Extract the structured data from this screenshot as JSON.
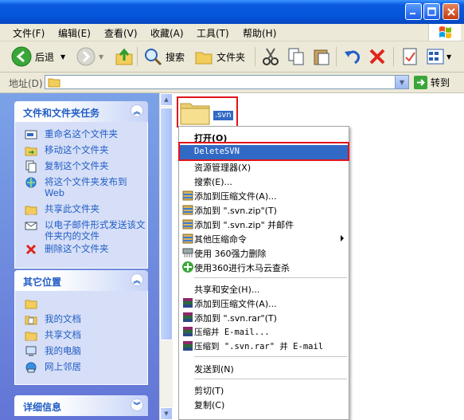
{
  "menubar": {
    "items": [
      "文件(F)",
      "编辑(E)",
      "查看(V)",
      "收藏(A)",
      "工具(T)",
      "帮助(H)"
    ]
  },
  "toolbar": {
    "back_label": "后退",
    "search_label": "搜索",
    "folders_label": "文件夹"
  },
  "addressbar": {
    "label": "地址(D)",
    "value": "",
    "go_label": "转到"
  },
  "left_pane": {
    "file_tasks": {
      "title": "文件和文件夹任务",
      "items": [
        "重命名这个文件夹",
        "移动这个文件夹",
        "复制这个文件夹",
        "将这个文件夹发布到 Web",
        "共享此文件夹",
        "以电子邮件形式发送该文件夹内的文件",
        "删除这个文件夹"
      ]
    },
    "other_places": {
      "title": "其它位置",
      "items": [
        "",
        "我的文档",
        "共享文档",
        "我的电脑",
        "网上邻居"
      ]
    },
    "details": {
      "title": "详细信息"
    }
  },
  "folder": {
    "name": ".svn"
  },
  "context_menu": {
    "items": [
      {
        "label": "打开(O)",
        "bold": true
      },
      {
        "label": "DeleteSVN",
        "highlighted": true
      },
      {
        "label": "资源管理器(X)"
      },
      {
        "label": "搜索(E)..."
      },
      {
        "label": "添加到压缩文件(A)...",
        "icon": "winrar-icon"
      },
      {
        "label": "添加到 \".svn.zip\"(T)",
        "icon": "winrar-icon"
      },
      {
        "label": "添加到 \".svn.zip\" 并邮件",
        "icon": "winrar-icon"
      },
      {
        "label": "其他压缩命令",
        "icon": "winrar-icon",
        "submenu": true
      },
      {
        "label": "使用 360强力删除",
        "icon": "shredder-icon"
      },
      {
        "label": "使用360进行木马云查杀",
        "icon": "360-icon"
      },
      {
        "label": "共享和安全(H)..."
      },
      {
        "label": "添加到压缩文件(A)...",
        "icon": "rar-books-icon"
      },
      {
        "label": "添加到 \".svn.rar\"(T)",
        "icon": "rar-books-icon"
      },
      {
        "label": "压缩并 E-mail...",
        "icon": "rar-books-icon"
      },
      {
        "label": "压缩到 \".svn.rar\" 并 E-mail",
        "icon": "rar-books-icon"
      },
      {
        "label": "发送到(N)"
      },
      {
        "label": "剪切(T)"
      },
      {
        "label": "复制(C)"
      }
    ]
  }
}
